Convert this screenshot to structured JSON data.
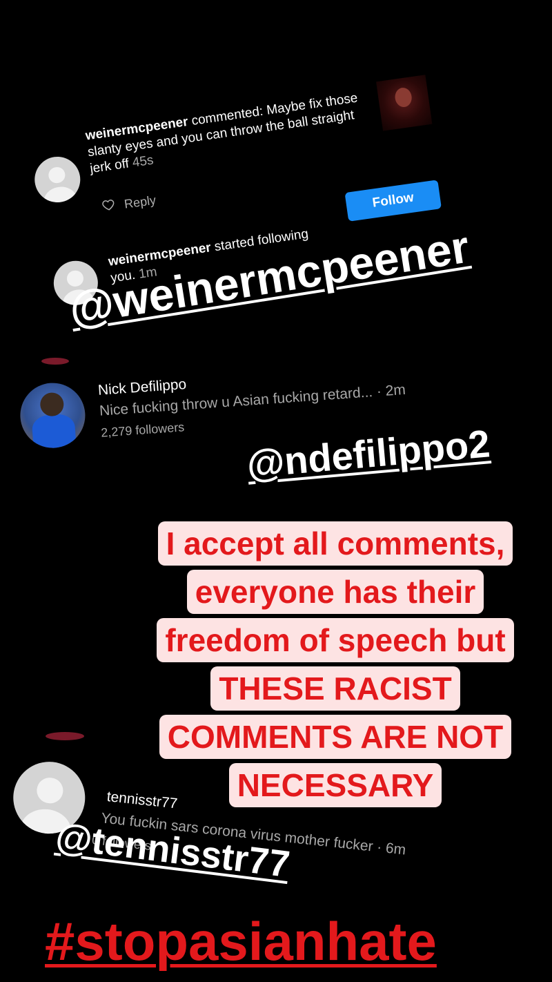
{
  "notification_comment": {
    "username": "weinermcpeener",
    "action": " commented: ",
    "text": "Maybe fix those slanty eyes and you can throw the ball straight jerk off ",
    "time": "45s",
    "reply_label": "Reply"
  },
  "notification_follow": {
    "username": "weinermcpeener",
    "action": " started following you. ",
    "time": "1m",
    "follow_label": "Follow",
    "button_color": "#1a8df5"
  },
  "sticker_mention_1": "@weinermcpeener",
  "dm_row": {
    "name": "Nick Defilippo",
    "message": "Nice fucking throw u Asian fucking retard...",
    "time": " · 2m",
    "followers": "2,279 followers"
  },
  "sticker_mention_2": "@ndefilippo2",
  "caption": {
    "lines": [
      "I accept all comments,",
      "everyone has their",
      "freedom of speech but",
      "THESE RACIST",
      "COMMENTS ARE NOT",
      "NECESSARY"
    ],
    "text_color": "#e3191c",
    "background_color": "#fde3e3"
  },
  "comment_three": {
    "name": "tennisstr77",
    "message": "You fuckin sars corona virus mother fucker",
    "time": " · 6m",
    "followers": "0 followers"
  },
  "sticker_mention_3": "@tennisstr77",
  "hashtag": "#stopasianhate",
  "hashtag_color": "#e3191c"
}
